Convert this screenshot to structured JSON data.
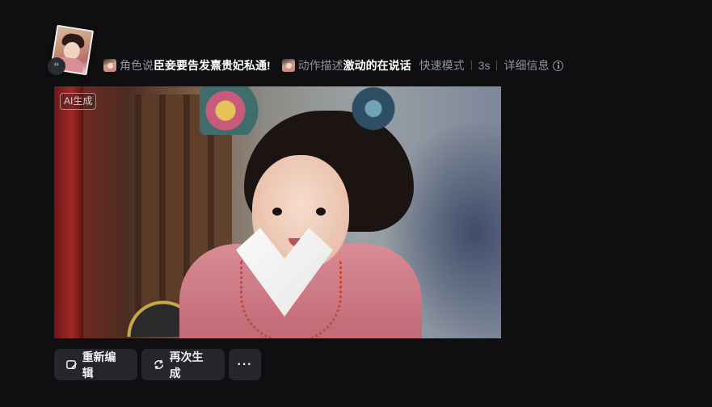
{
  "prompt": {
    "role_label": "角色说",
    "role_text": "臣妾要告发熹贵妃私通!",
    "action_label": "动作描述",
    "action_text": "激动的在说话",
    "mode": "快速模式",
    "duration": "3s",
    "details_link": "详细信息",
    "quote_badge": "“"
  },
  "video": {
    "ai_badge": "AI生成"
  },
  "actions": {
    "edit_label": "重新编辑",
    "regenerate_label": "再次生成",
    "more_label": "···"
  },
  "icons": {
    "info": "info-icon",
    "edit": "edit-icon",
    "regenerate": "refresh-icon",
    "more": "more-icon"
  }
}
